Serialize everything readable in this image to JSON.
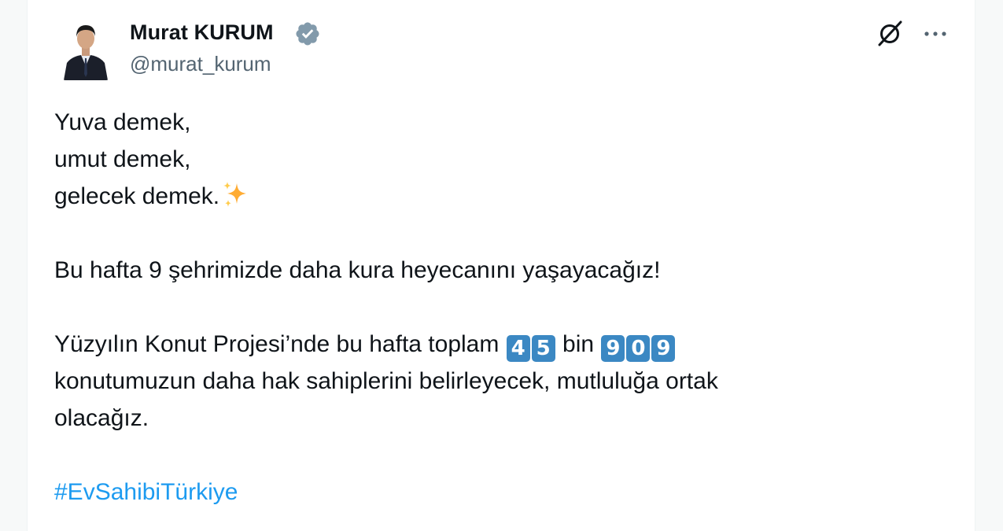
{
  "author": {
    "name": "Murat KURUM",
    "handle": "@murat_kurum",
    "verified": true
  },
  "header_icons": {
    "grok": "grok-icon",
    "more": "more-icon"
  },
  "tweet": {
    "line1": "Yuva demek,",
    "line2": "umut demek,",
    "line3": "gelecek demek.",
    "line3_emoji": "sparkles",
    "line4": "Bu hafta 9 şehrimizde daha kura heyecanını yaşayacağız!",
    "line5_prefix": "Yüzyılın Konut Projesi’nde bu hafta toplam",
    "number1_digits": [
      "4",
      "5"
    ],
    "line5_middle": "bin",
    "number2_digits": [
      "9",
      "0",
      "9"
    ],
    "line6": "konutumuzun daha hak sahiplerini belirleyecek, mutluluğa ortak",
    "line7": "olacağız.",
    "hashtag": "#EvSahibiTürkiye"
  },
  "colors": {
    "text": "#0f1419",
    "secondary": "#536471",
    "accent": "#1d9bf0",
    "keycap": "#3b88c3",
    "verified": "#829aab"
  }
}
